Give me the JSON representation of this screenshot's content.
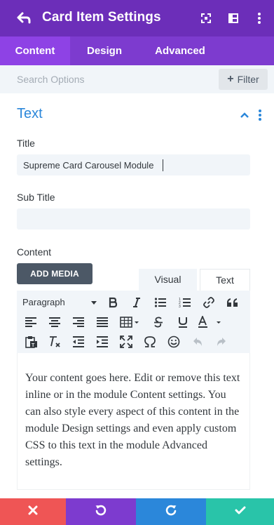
{
  "header": {
    "title": "Card Item Settings",
    "bg_color": "#6c2eb9",
    "icons": [
      "back-arrow-icon",
      "fullscreen-icon",
      "split-view-icon",
      "more-icon"
    ]
  },
  "tabs": [
    {
      "label": "Content",
      "active": true
    },
    {
      "label": "Design",
      "active": false
    },
    {
      "label": "Advanced",
      "active": false
    }
  ],
  "search": {
    "placeholder": "Search Options",
    "filter_label": "Filter"
  },
  "section": {
    "title": "Text",
    "accent_color": "#2b87da"
  },
  "fields": {
    "title_label": "Title",
    "title_value": "Supreme Card Carousel Module",
    "subtitle_label": "Sub Title",
    "subtitle_value": "",
    "content_label": "Content"
  },
  "editor": {
    "add_media_label": "ADD MEDIA",
    "tab_visual": "Visual",
    "tab_text": "Text",
    "format_select": "Paragraph",
    "body": "Your content goes here. Edit or remove this text inline or in the module Content settings. You can also style every aspect of this content in the module Design settings and even apply custom CSS to this text in the module Advanced settings."
  },
  "footer": {
    "buttons": [
      {
        "icon": "close-icon",
        "color": "#ef5555"
      },
      {
        "icon": "undo-icon",
        "color": "#7d3bcf"
      },
      {
        "icon": "redo-icon",
        "color": "#2b87da"
      },
      {
        "icon": "check-icon",
        "color": "#29c4a9"
      }
    ]
  }
}
